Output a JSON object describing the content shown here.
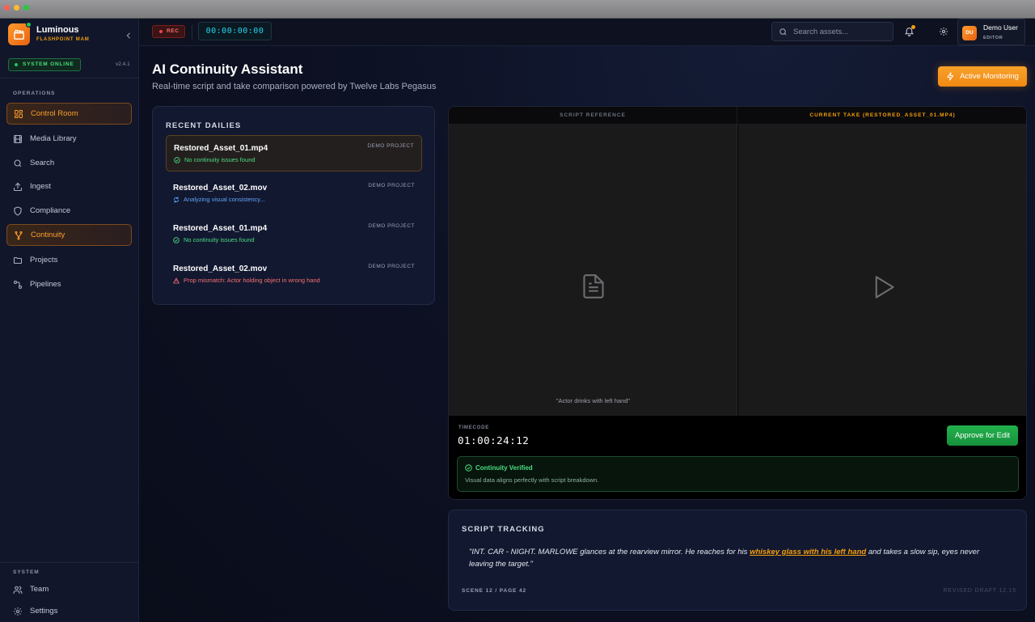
{
  "brand": {
    "name": "Luminous",
    "subtitle": "FLASHPOINT MAM"
  },
  "system": {
    "status": "SYSTEM ONLINE",
    "version": "v2.4.1"
  },
  "sidebar": {
    "operations_label": "OPERATIONS",
    "items": [
      {
        "label": "Control Room",
        "icon": "layout-grid-icon",
        "active": true
      },
      {
        "label": "Media Library",
        "icon": "film-icon",
        "active": false
      },
      {
        "label": "Search",
        "icon": "search-icon",
        "active": false
      },
      {
        "label": "Ingest",
        "icon": "upload-icon",
        "active": false
      },
      {
        "label": "Compliance",
        "icon": "shield-icon",
        "active": false
      },
      {
        "label": "Continuity",
        "icon": "git-merge-icon",
        "active": true
      },
      {
        "label": "Projects",
        "icon": "folder-icon",
        "active": false
      },
      {
        "label": "Pipelines",
        "icon": "workflow-icon",
        "active": false
      }
    ],
    "system_label": "SYSTEM",
    "system_items": [
      {
        "label": "Team",
        "icon": "users-icon"
      },
      {
        "label": "Settings",
        "icon": "gear-icon"
      }
    ]
  },
  "topbar": {
    "rec_label": "REC",
    "timecode": "00:00:00:00",
    "search_placeholder": "Search assets...",
    "user": {
      "initials": "DU",
      "name": "Demo User",
      "role": "EDITOR"
    }
  },
  "page": {
    "title": "AI Continuity Assistant",
    "subtitle": "Real-time script and take comparison powered by Twelve Labs Pegasus",
    "monitor_button": "Active Monitoring"
  },
  "dailies": {
    "heading": "RECENT DAILIES",
    "items": [
      {
        "name": "Restored_Asset_01.mp4",
        "project": "DEMO PROJECT",
        "status": "No continuity issues found",
        "state": "ok"
      },
      {
        "name": "Restored_Asset_02.mov",
        "project": "DEMO PROJECT",
        "status": "Analyzing visual consistency...",
        "state": "busy"
      },
      {
        "name": "Restored_Asset_01.mp4",
        "project": "DEMO PROJECT",
        "status": "No continuity issues found",
        "state": "ok"
      },
      {
        "name": "Restored_Asset_02.mov",
        "project": "DEMO PROJECT",
        "status": "Prop mismatch: Actor holding object in wrong hand",
        "state": "err"
      }
    ]
  },
  "compare": {
    "left_heading": "SCRIPT REFERENCE",
    "right_heading": "CURRENT TAKE (RESTORED_ASSET_01.MP4)",
    "left_caption": "\"Actor drinks with left hand\"",
    "timecode_label": "TIMECODE",
    "timecode": "01:00:24:12",
    "approve_button": "Approve for Edit",
    "verified_title": "Continuity Verified",
    "verified_body": "Visual data aligns perfectly with script breakdown."
  },
  "script": {
    "heading": "SCRIPT TRACKING",
    "text_before": "\"INT. CAR - NIGHT. MARLOWE glances at the rearview mirror. He reaches for his ",
    "text_highlight": "whiskey glass with his left hand",
    "text_after": " and takes a slow sip, eyes never leaving the target.\"",
    "scene": "SCENE 12 / PAGE 42",
    "draft": "REVISED DRAFT 12.15"
  },
  "colors": {
    "accent": "#f59e0b",
    "success": "#22c55e",
    "danger": "#ef4444",
    "info": "#60a5fa"
  }
}
